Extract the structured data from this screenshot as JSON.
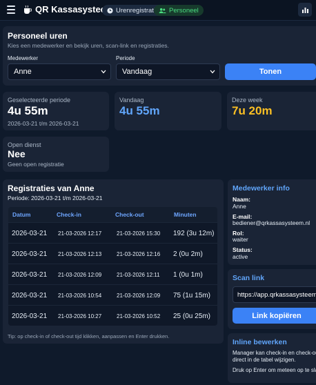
{
  "header": {
    "app_title": "QR Kassasysteem",
    "nav": [
      {
        "label": "Urenregistratie",
        "icon": "clock-icon",
        "active": false
      },
      {
        "label": "Personeel",
        "icon": "users-icon",
        "active": true
      }
    ]
  },
  "filters": {
    "title": "Personeel uren",
    "subtitle": "Kies een medewerker en bekijk uren, scan-link en registraties.",
    "employee_label": "Medewerker",
    "employee_value": "Anne",
    "period_label": "Periode",
    "period_value": "Vandaag",
    "show_button": "Tonen"
  },
  "stats": {
    "selected": {
      "label": "Geselecteerde periode",
      "value": "4u 55m",
      "sub": "2026-03-21 t/m 2026-03-21"
    },
    "today": {
      "label": "Vandaag",
      "value": "4u 55m"
    },
    "week": {
      "label": "Deze week",
      "value": "7u 20m"
    },
    "open": {
      "label": "Open dienst",
      "value": "Nee",
      "sub": "Geen open registratie"
    }
  },
  "registrations": {
    "title": "Registraties van Anne",
    "period": "Periode: 2026-03-21 t/m 2026-03-21",
    "columns": [
      "Datum",
      "Check-in",
      "Check-out",
      "Minuten"
    ],
    "rows": [
      {
        "date": "2026-03-21",
        "in": "21-03-2026 12:17",
        "out": "21-03-2026 15:30",
        "min": "192 (3u 12m)"
      },
      {
        "date": "2026-03-21",
        "in": "21-03-2026 12:13",
        "out": "21-03-2026 12:16",
        "min": "2 (0u 2m)"
      },
      {
        "date": "2026-03-21",
        "in": "21-03-2026 12:09",
        "out": "21-03-2026 12:11",
        "min": "1 (0u 1m)"
      },
      {
        "date": "2026-03-21",
        "in": "21-03-2026 10:54",
        "out": "21-03-2026 12:09",
        "min": "75 (1u 15m)"
      },
      {
        "date": "2026-03-21",
        "in": "21-03-2026 10:27",
        "out": "21-03-2026 10:52",
        "min": "25 (0u 25m)"
      }
    ],
    "tip": "Tip: op check-in of check-out tijd klikken, aanpassen en Enter drukken."
  },
  "employee_info": {
    "title": "Medewerker info",
    "name_label": "Naam:",
    "name": "Anne",
    "email_label": "E-mail:",
    "email": "bediener@qrkassasysteem.nl",
    "role_label": "Rol:",
    "role": "waiter",
    "status_label": "Status:",
    "status": "active"
  },
  "scan_link": {
    "title": "Scan link",
    "url": "https://app.qrkassasysteem.nl",
    "copy_button": "Link kopiëren"
  },
  "inline_edit": {
    "title": "Inline bewerken",
    "text1": "Manager kan check-in en check-out",
    "text2": "direct in de tabel wijzigen.",
    "text3": "Druk op Enter om meteen op te slaan"
  },
  "colors": {
    "accent": "#3b82f6",
    "today_value": "#60a5fa",
    "week_value": "#fbbf24",
    "active_nav": "#4ade80"
  }
}
